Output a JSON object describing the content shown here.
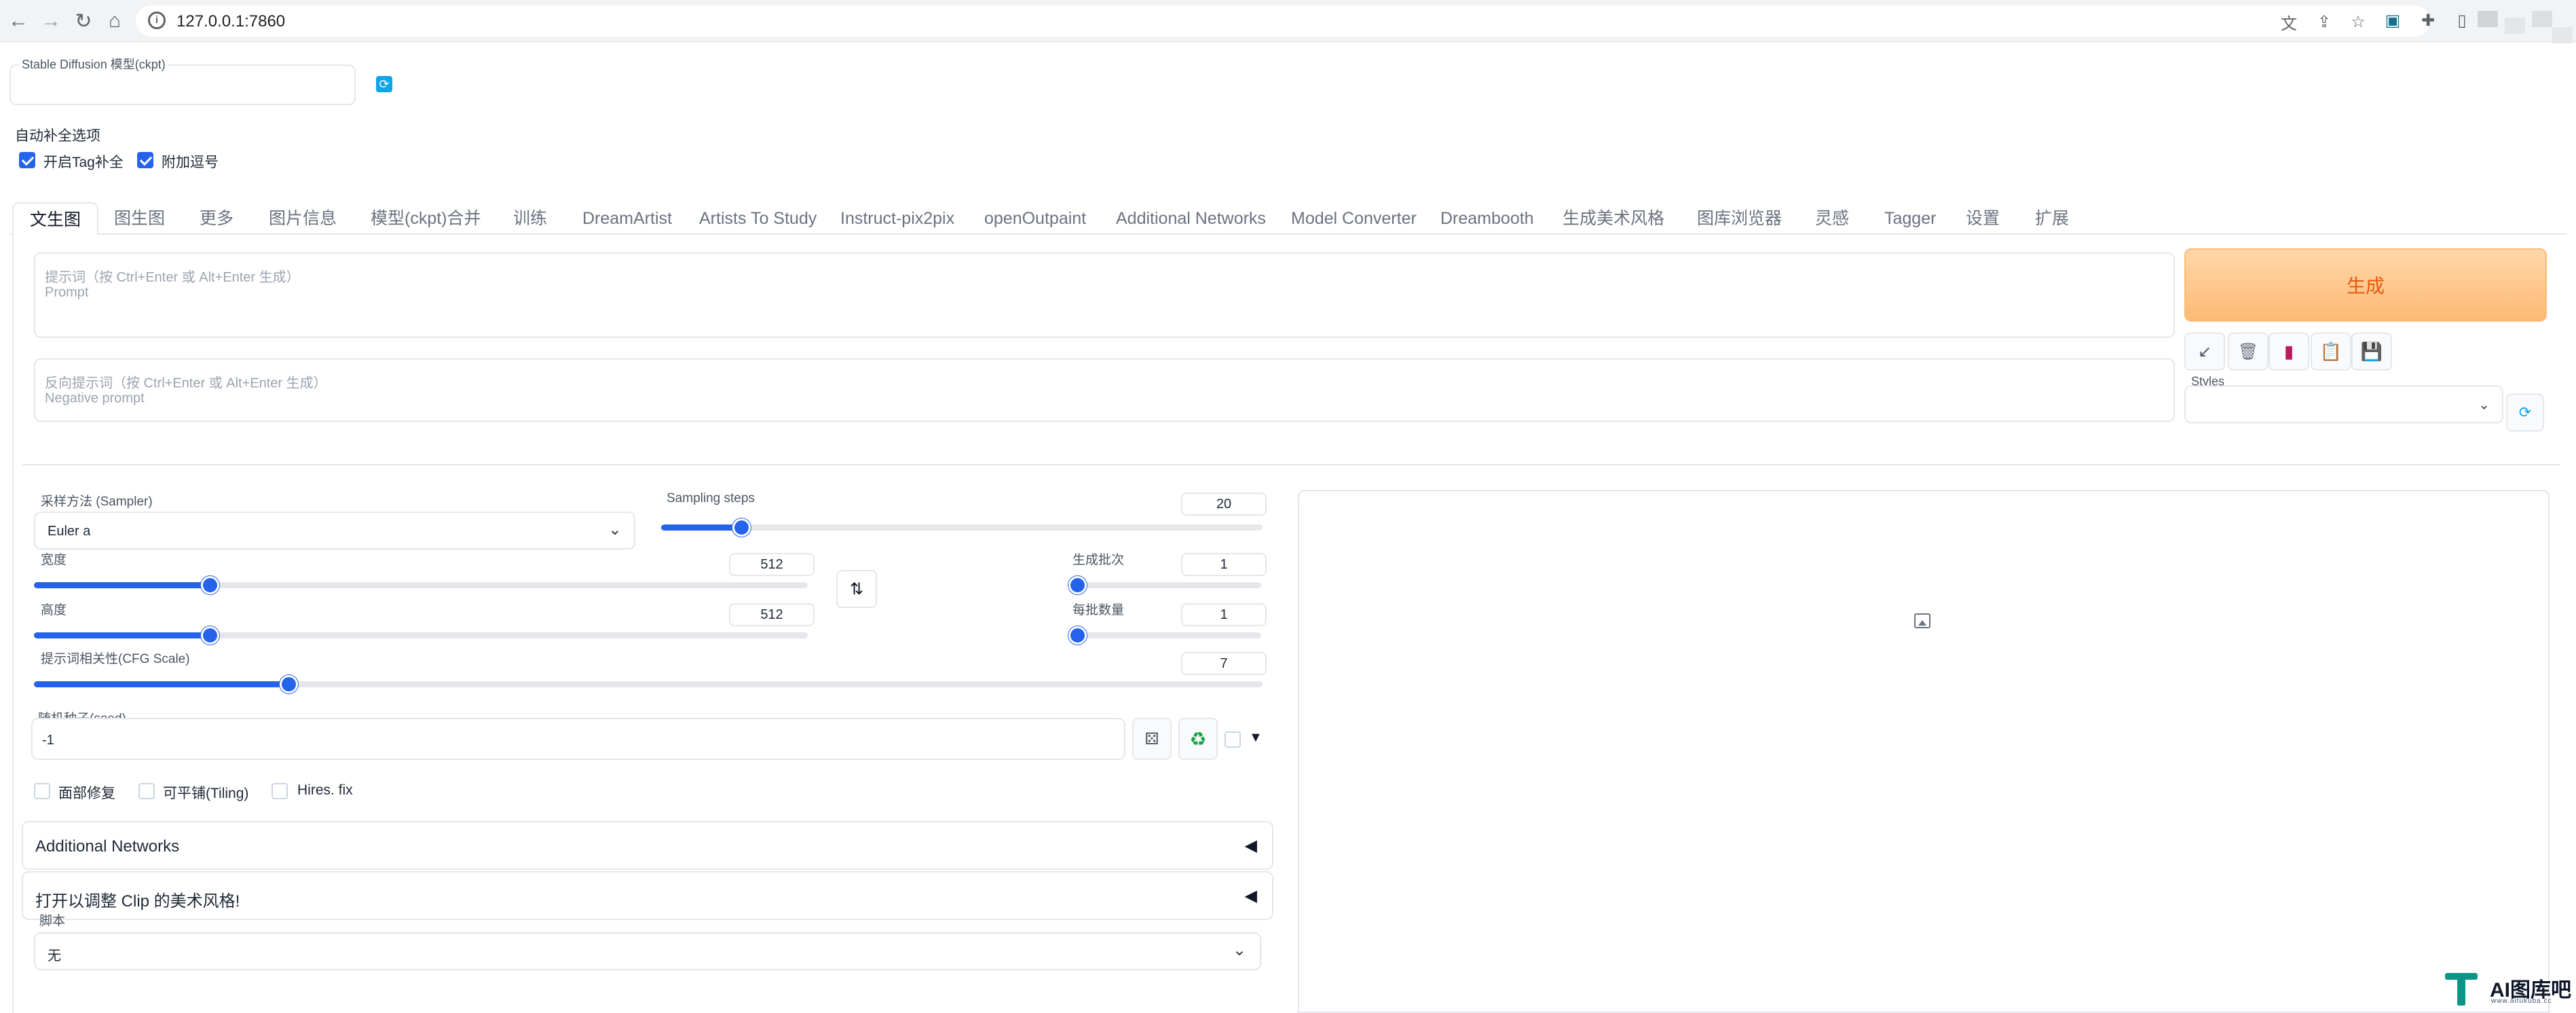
{
  "browser": {
    "url": "127.0.0.1:7860"
  },
  "model": {
    "label": "Stable Diffusion 模型(ckpt)",
    "value": ""
  },
  "autocomplete": {
    "title": "自动补全选项",
    "options": [
      {
        "label": "开启Tag补全",
        "checked": true
      },
      {
        "label": "附加逗号",
        "checked": true
      }
    ]
  },
  "tabs": [
    "文生图",
    "图生图",
    "更多",
    "图片信息",
    "模型(ckpt)合并",
    "训练",
    "DreamArtist",
    "Artists To Study",
    "Instruct-pix2pix",
    "openOutpaint",
    "Additional Networks",
    "Model Converter",
    "Dreambooth",
    "生成美术风格",
    "图库浏览器",
    "灵感",
    "Tagger",
    "设置",
    "扩展"
  ],
  "prompt": {
    "placeholder_line1": "提示词（按 Ctrl+Enter 或 Alt+Enter 生成）",
    "placeholder_line2": "Prompt"
  },
  "negative_prompt": {
    "placeholder_line1": "反向提示词（按 Ctrl+Enter 或 Alt+Enter 生成）",
    "placeholder_line2": "Negative prompt"
  },
  "generate_button": "生成",
  "styles": {
    "label": "Styles",
    "value": ""
  },
  "sampler": {
    "label": "采样方法 (Sampler)",
    "value": "Euler a"
  },
  "sampling_steps": {
    "label": "Sampling steps",
    "value": "20",
    "fraction": 0.133
  },
  "width": {
    "label": "宽度",
    "value": "512",
    "fraction": 0.227
  },
  "height": {
    "label": "高度",
    "value": "512",
    "fraction": 0.227
  },
  "batch_count": {
    "label": "生成批次",
    "value": "1",
    "fraction": 0.0
  },
  "batch_size": {
    "label": "每批数量",
    "value": "1",
    "fraction": 0.0
  },
  "cfg_scale": {
    "label": "提示词相关性(CFG Scale)",
    "value": "7",
    "fraction": 0.207
  },
  "seed": {
    "label": "随机种子(seed)",
    "value": "-1"
  },
  "options": [
    {
      "label": "面部修复",
      "checked": false
    },
    {
      "label": "可平铺(Tiling)",
      "checked": false
    },
    {
      "label": "Hires. fix",
      "checked": false
    }
  ],
  "sections": {
    "additional_networks": "Additional Networks",
    "clip_style": "打开以调整 Clip 的美术风格!"
  },
  "script": {
    "label": "脚本",
    "value": "无"
  },
  "watermark": {
    "text": "AI图库吧",
    "sub": "www.aitukuba.cc"
  },
  "colors": {
    "accent": "#2563eb",
    "generate_bg": "#fdc89a",
    "generate_text": "#ea580c"
  }
}
